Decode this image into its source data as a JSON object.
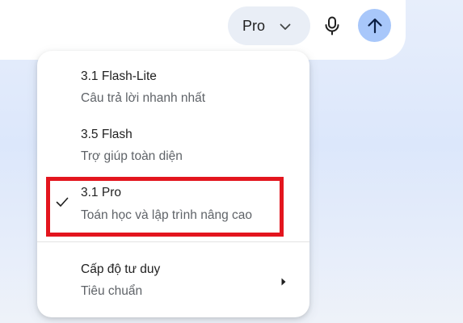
{
  "model_selector": {
    "current": "Pro"
  },
  "menu": {
    "items": [
      {
        "title": "3.1 Flash-Lite",
        "subtitle": "Câu trả lời nhanh nhất",
        "selected": false
      },
      {
        "title": "3.5 Flash",
        "subtitle": "Trợ giúp toàn diện",
        "selected": false
      },
      {
        "title": "3.1 Pro",
        "subtitle": "Toán học và lập trình nâng cao",
        "selected": true
      }
    ],
    "thinking": {
      "title": "Cấp độ tư duy",
      "value": "Tiêu chuẩn"
    }
  },
  "icons": {
    "dropdown": "chevron-down-icon",
    "mic": "mic-icon",
    "send": "arrow-up-icon",
    "selected": "check-icon",
    "submenu": "caret-right-icon"
  },
  "colors": {
    "send_button": "#a8c7fa",
    "model_button": "#e9eef6",
    "highlight_box": "#e3151e"
  }
}
